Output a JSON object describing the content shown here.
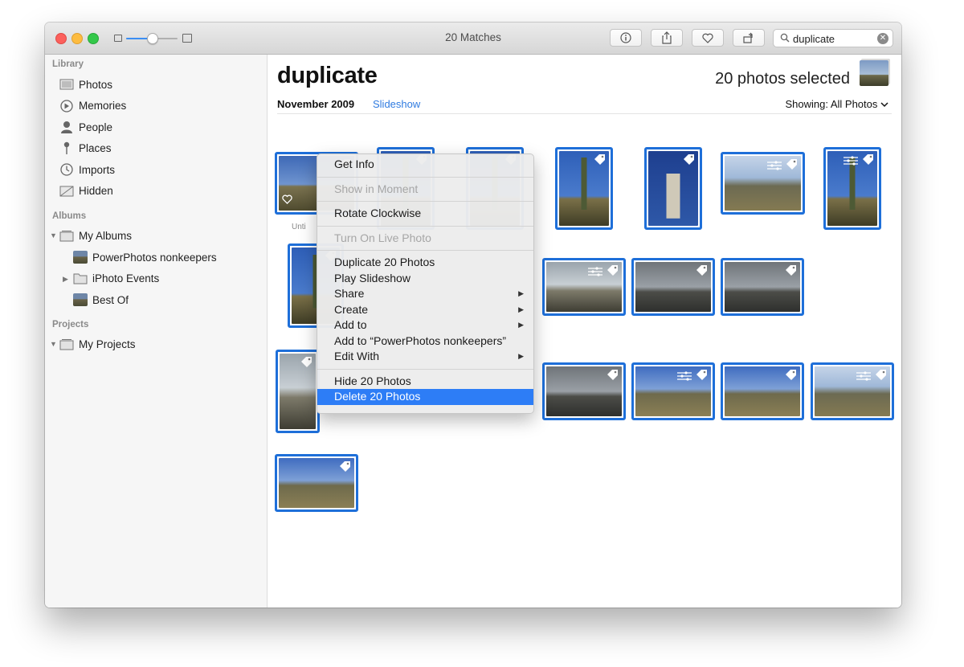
{
  "window": {
    "title": "20 Matches",
    "search_value": "duplicate"
  },
  "sidebar": {
    "library_header": "Library",
    "library_items": [
      {
        "label": "Photos",
        "icon": "photos-icon"
      },
      {
        "label": "Memories",
        "icon": "memories-icon"
      },
      {
        "label": "People",
        "icon": "people-icon"
      },
      {
        "label": "Places",
        "icon": "places-icon"
      },
      {
        "label": "Imports",
        "icon": "imports-icon"
      },
      {
        "label": "Hidden",
        "icon": "hidden-icon"
      }
    ],
    "albums_header": "Albums",
    "my_albums": "My Albums",
    "album_items": [
      "PowerPhotos nonkeepers",
      "iPhoto Events",
      "Best Of"
    ],
    "projects_header": "Projects",
    "my_projects": "My Projects"
  },
  "content": {
    "heading": "duplicate",
    "selected_count": "20 photos selected",
    "date": "November 2009",
    "slideshow": "Slideshow",
    "showing": "Showing: All Photos",
    "untitled_caption": "Unti",
    "photos": [
      {
        "style": "desert",
        "heart": true,
        "adjusted": false
      },
      {
        "style": "cactus",
        "heart": false,
        "adjusted": false
      },
      {
        "style": "cactus",
        "heart": false,
        "adjusted": false
      },
      {
        "style": "cactus",
        "heart": false,
        "adjusted": false
      },
      {
        "style": "tall",
        "heart": false,
        "adjusted": false
      },
      {
        "style": "mtn",
        "heart": false,
        "adjusted": true
      },
      {
        "style": "cactus",
        "heart": false,
        "adjusted": true
      },
      {
        "style": "cactus",
        "heart": false,
        "adjusted": false
      },
      {
        "style": "cloud",
        "heart": false,
        "adjusted": true
      },
      {
        "style": "road",
        "heart": false,
        "adjusted": false
      },
      {
        "style": "road",
        "heart": false,
        "adjusted": false
      },
      {
        "style": "cloud",
        "heart": false,
        "adjusted": false
      },
      {
        "style": "road",
        "heart": false,
        "adjusted": false
      },
      {
        "style": "scrub",
        "heart": false,
        "adjusted": true
      },
      {
        "style": "scrub",
        "heart": false,
        "adjusted": false
      },
      {
        "style": "mtn",
        "heart": false,
        "adjusted": true
      },
      {
        "style": "scrub",
        "heart": false,
        "adjusted": false
      }
    ]
  },
  "context_menu": {
    "items": [
      {
        "label": "Get Info",
        "disabled": false
      },
      {
        "separator": true
      },
      {
        "label": "Show in Moment",
        "disabled": true
      },
      {
        "separator": true
      },
      {
        "label": "Rotate Clockwise",
        "disabled": false
      },
      {
        "separator": true
      },
      {
        "label": "Turn On Live Photo",
        "disabled": true
      },
      {
        "separator": true
      },
      {
        "label": "Duplicate 20 Photos",
        "disabled": false
      },
      {
        "label": "Play Slideshow",
        "disabled": false
      },
      {
        "label": "Share",
        "disabled": false,
        "submenu": true
      },
      {
        "label": "Create",
        "disabled": false,
        "submenu": true
      },
      {
        "label": "Add to",
        "disabled": false,
        "submenu": true
      },
      {
        "label": "Add to “PowerPhotos nonkeepers”",
        "disabled": false
      },
      {
        "label": "Edit With",
        "disabled": false,
        "submenu": true
      },
      {
        "separator": true
      },
      {
        "label": "Hide 20 Photos",
        "disabled": false
      },
      {
        "label": "Delete 20 Photos",
        "disabled": false,
        "selected": true
      }
    ]
  },
  "colors": {
    "accent": "#2d7df6",
    "selection_border": "#1e6fd9",
    "link": "#2f7be0"
  }
}
